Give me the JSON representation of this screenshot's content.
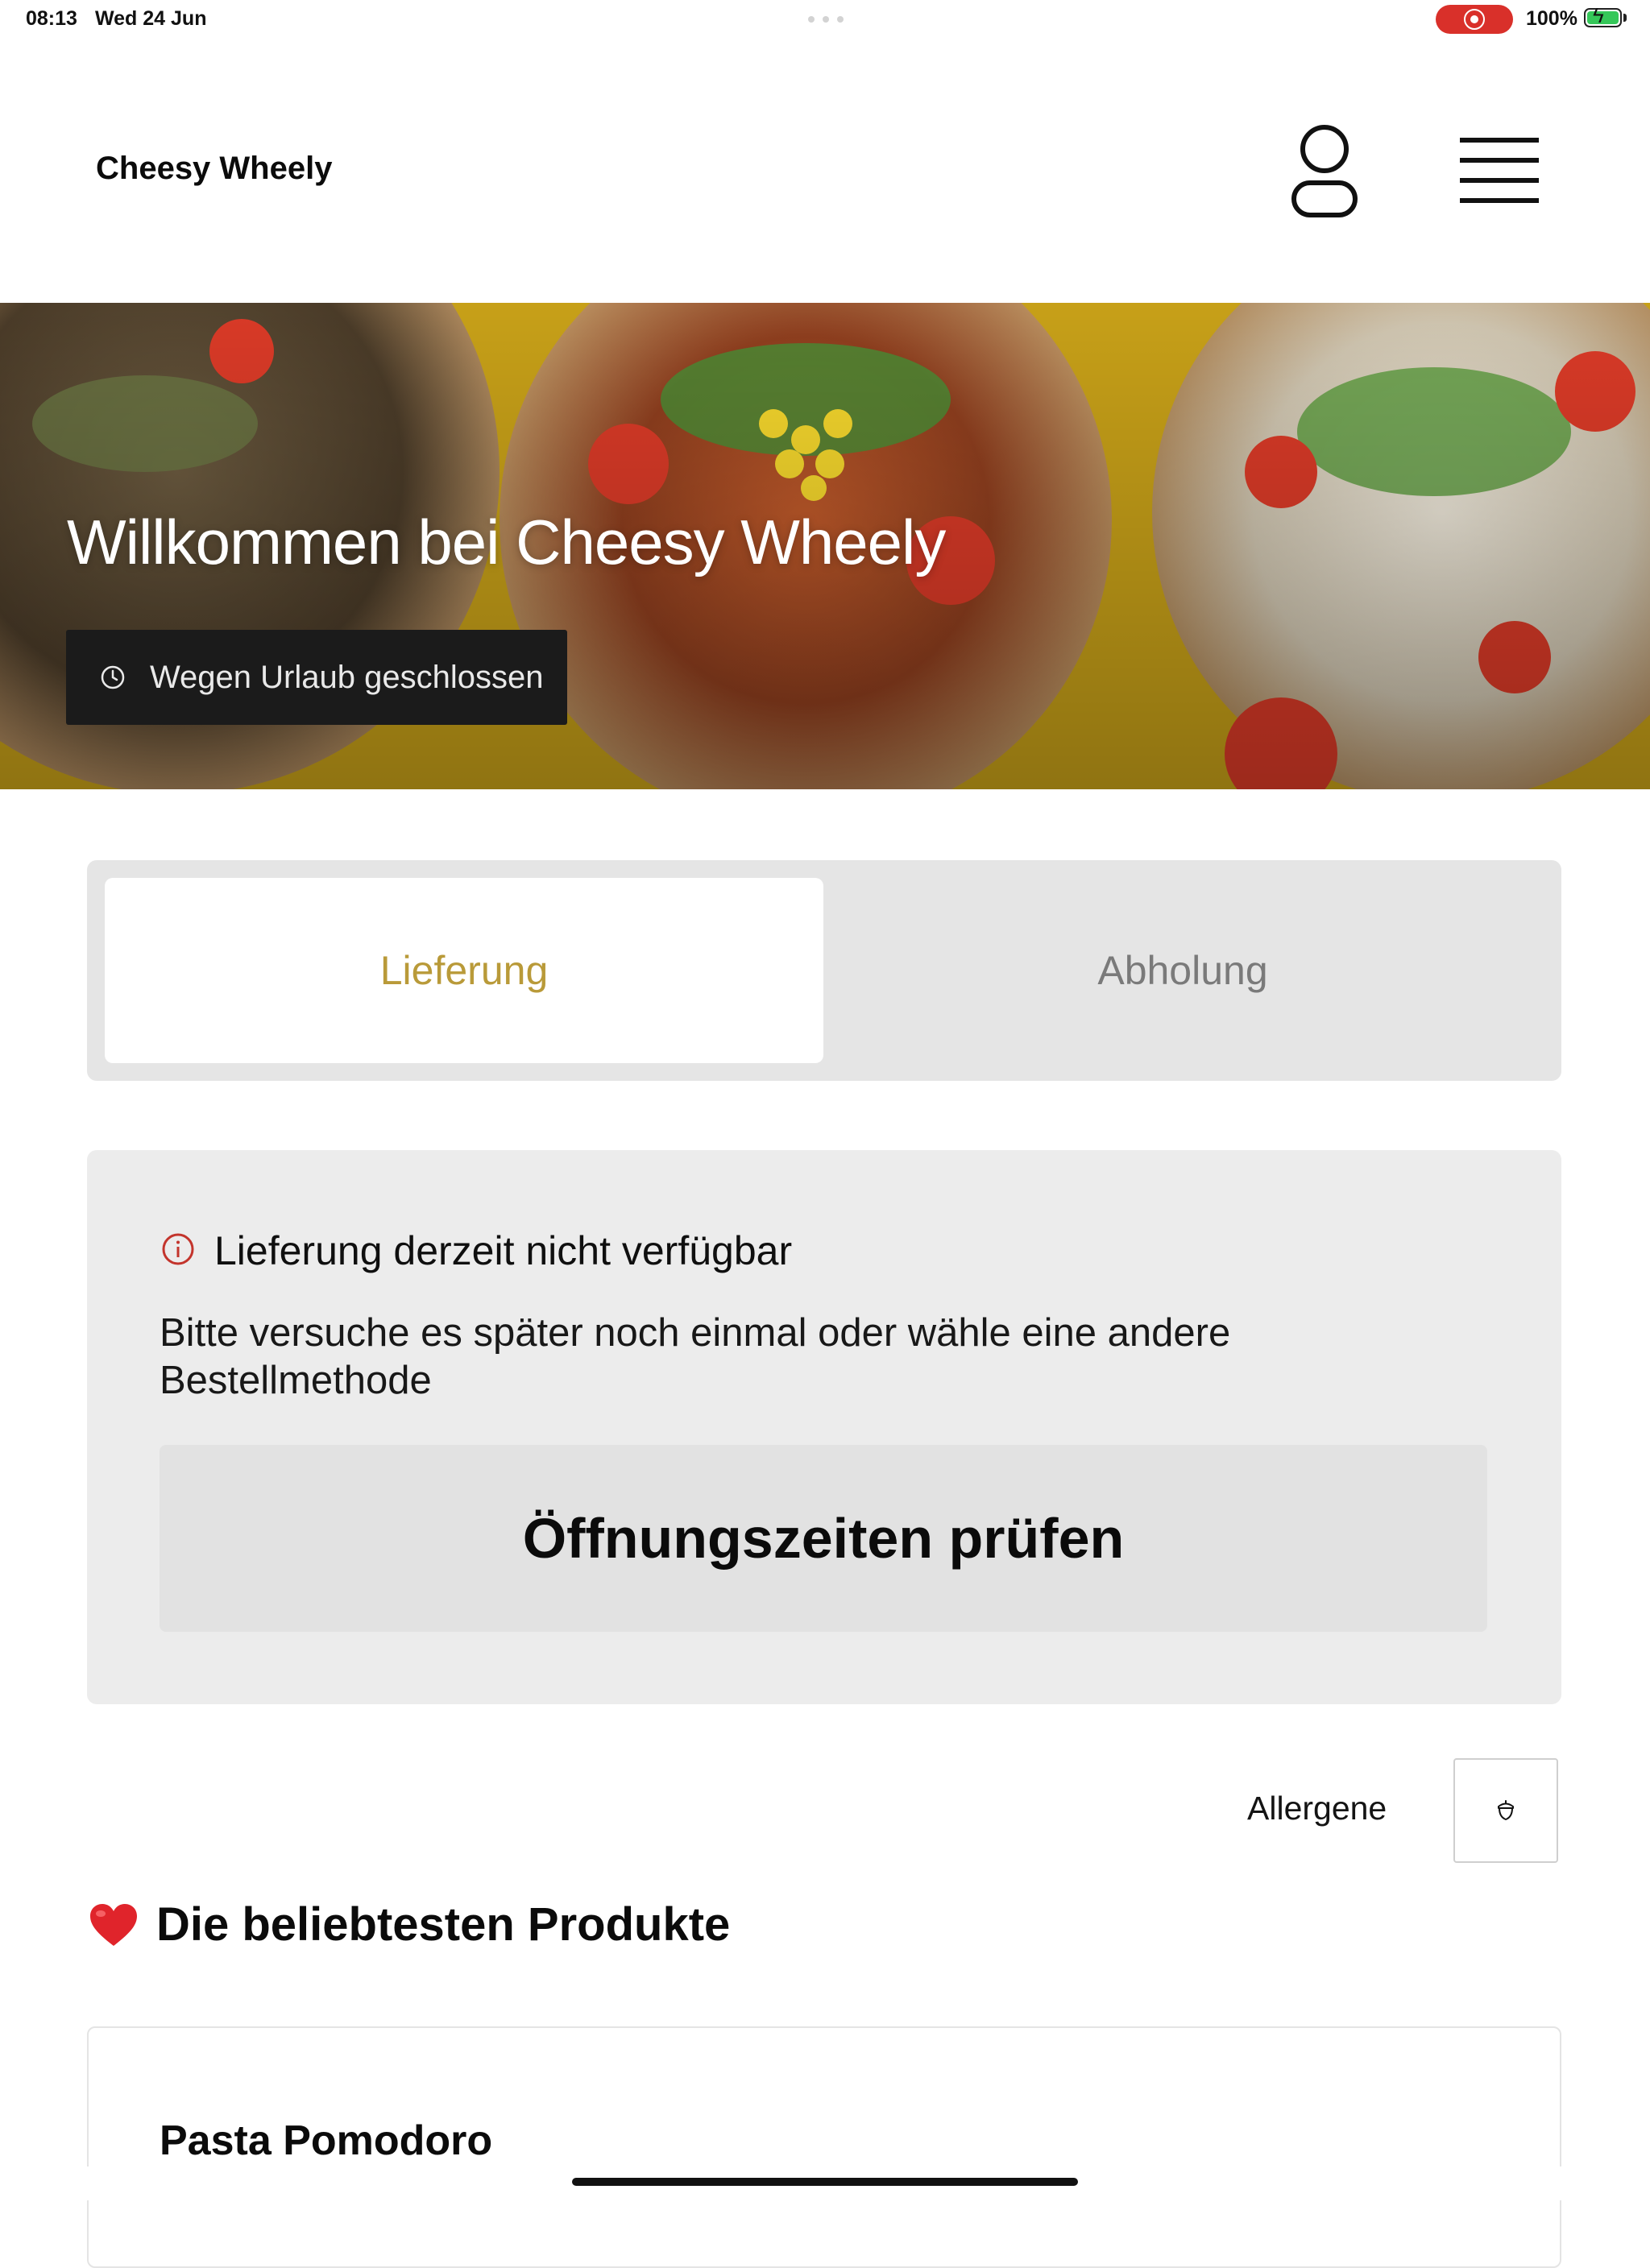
{
  "status_bar": {
    "time": "08:13",
    "date": "Wed 24 Jun",
    "battery": "100%",
    "recording_color": "#d9302a",
    "battery_color": "#35c759"
  },
  "header": {
    "brand": "Cheesy Wheely",
    "user_icon": "user-icon",
    "menu_icon": "hamburger-menu-icon"
  },
  "hero": {
    "title": "Willkommen bei Cheesy Wheely",
    "status_label": "Wegen Urlaub geschlossen",
    "status_icon": "clock-icon"
  },
  "order_method": {
    "tabs": [
      {
        "label": "Lieferung",
        "active": true
      },
      {
        "label": "Abholung",
        "active": false
      }
    ],
    "active_color": "#b99a39"
  },
  "notice": {
    "icon": "info-icon",
    "icon_color": "#c3342c",
    "title": "Lieferung derzeit nicht verfügbar",
    "text": "Bitte versuche es später noch einmal oder wähle eine andere Bestellmethode",
    "button_label": "Öffnungszeiten prüfen"
  },
  "allergens": {
    "label": "Allergene",
    "icon": "acorn-icon"
  },
  "popular": {
    "icon": "heart-icon",
    "title": "Die beliebtesten Produkte",
    "products": [
      {
        "name": "Pasta Pomodoro"
      }
    ]
  }
}
